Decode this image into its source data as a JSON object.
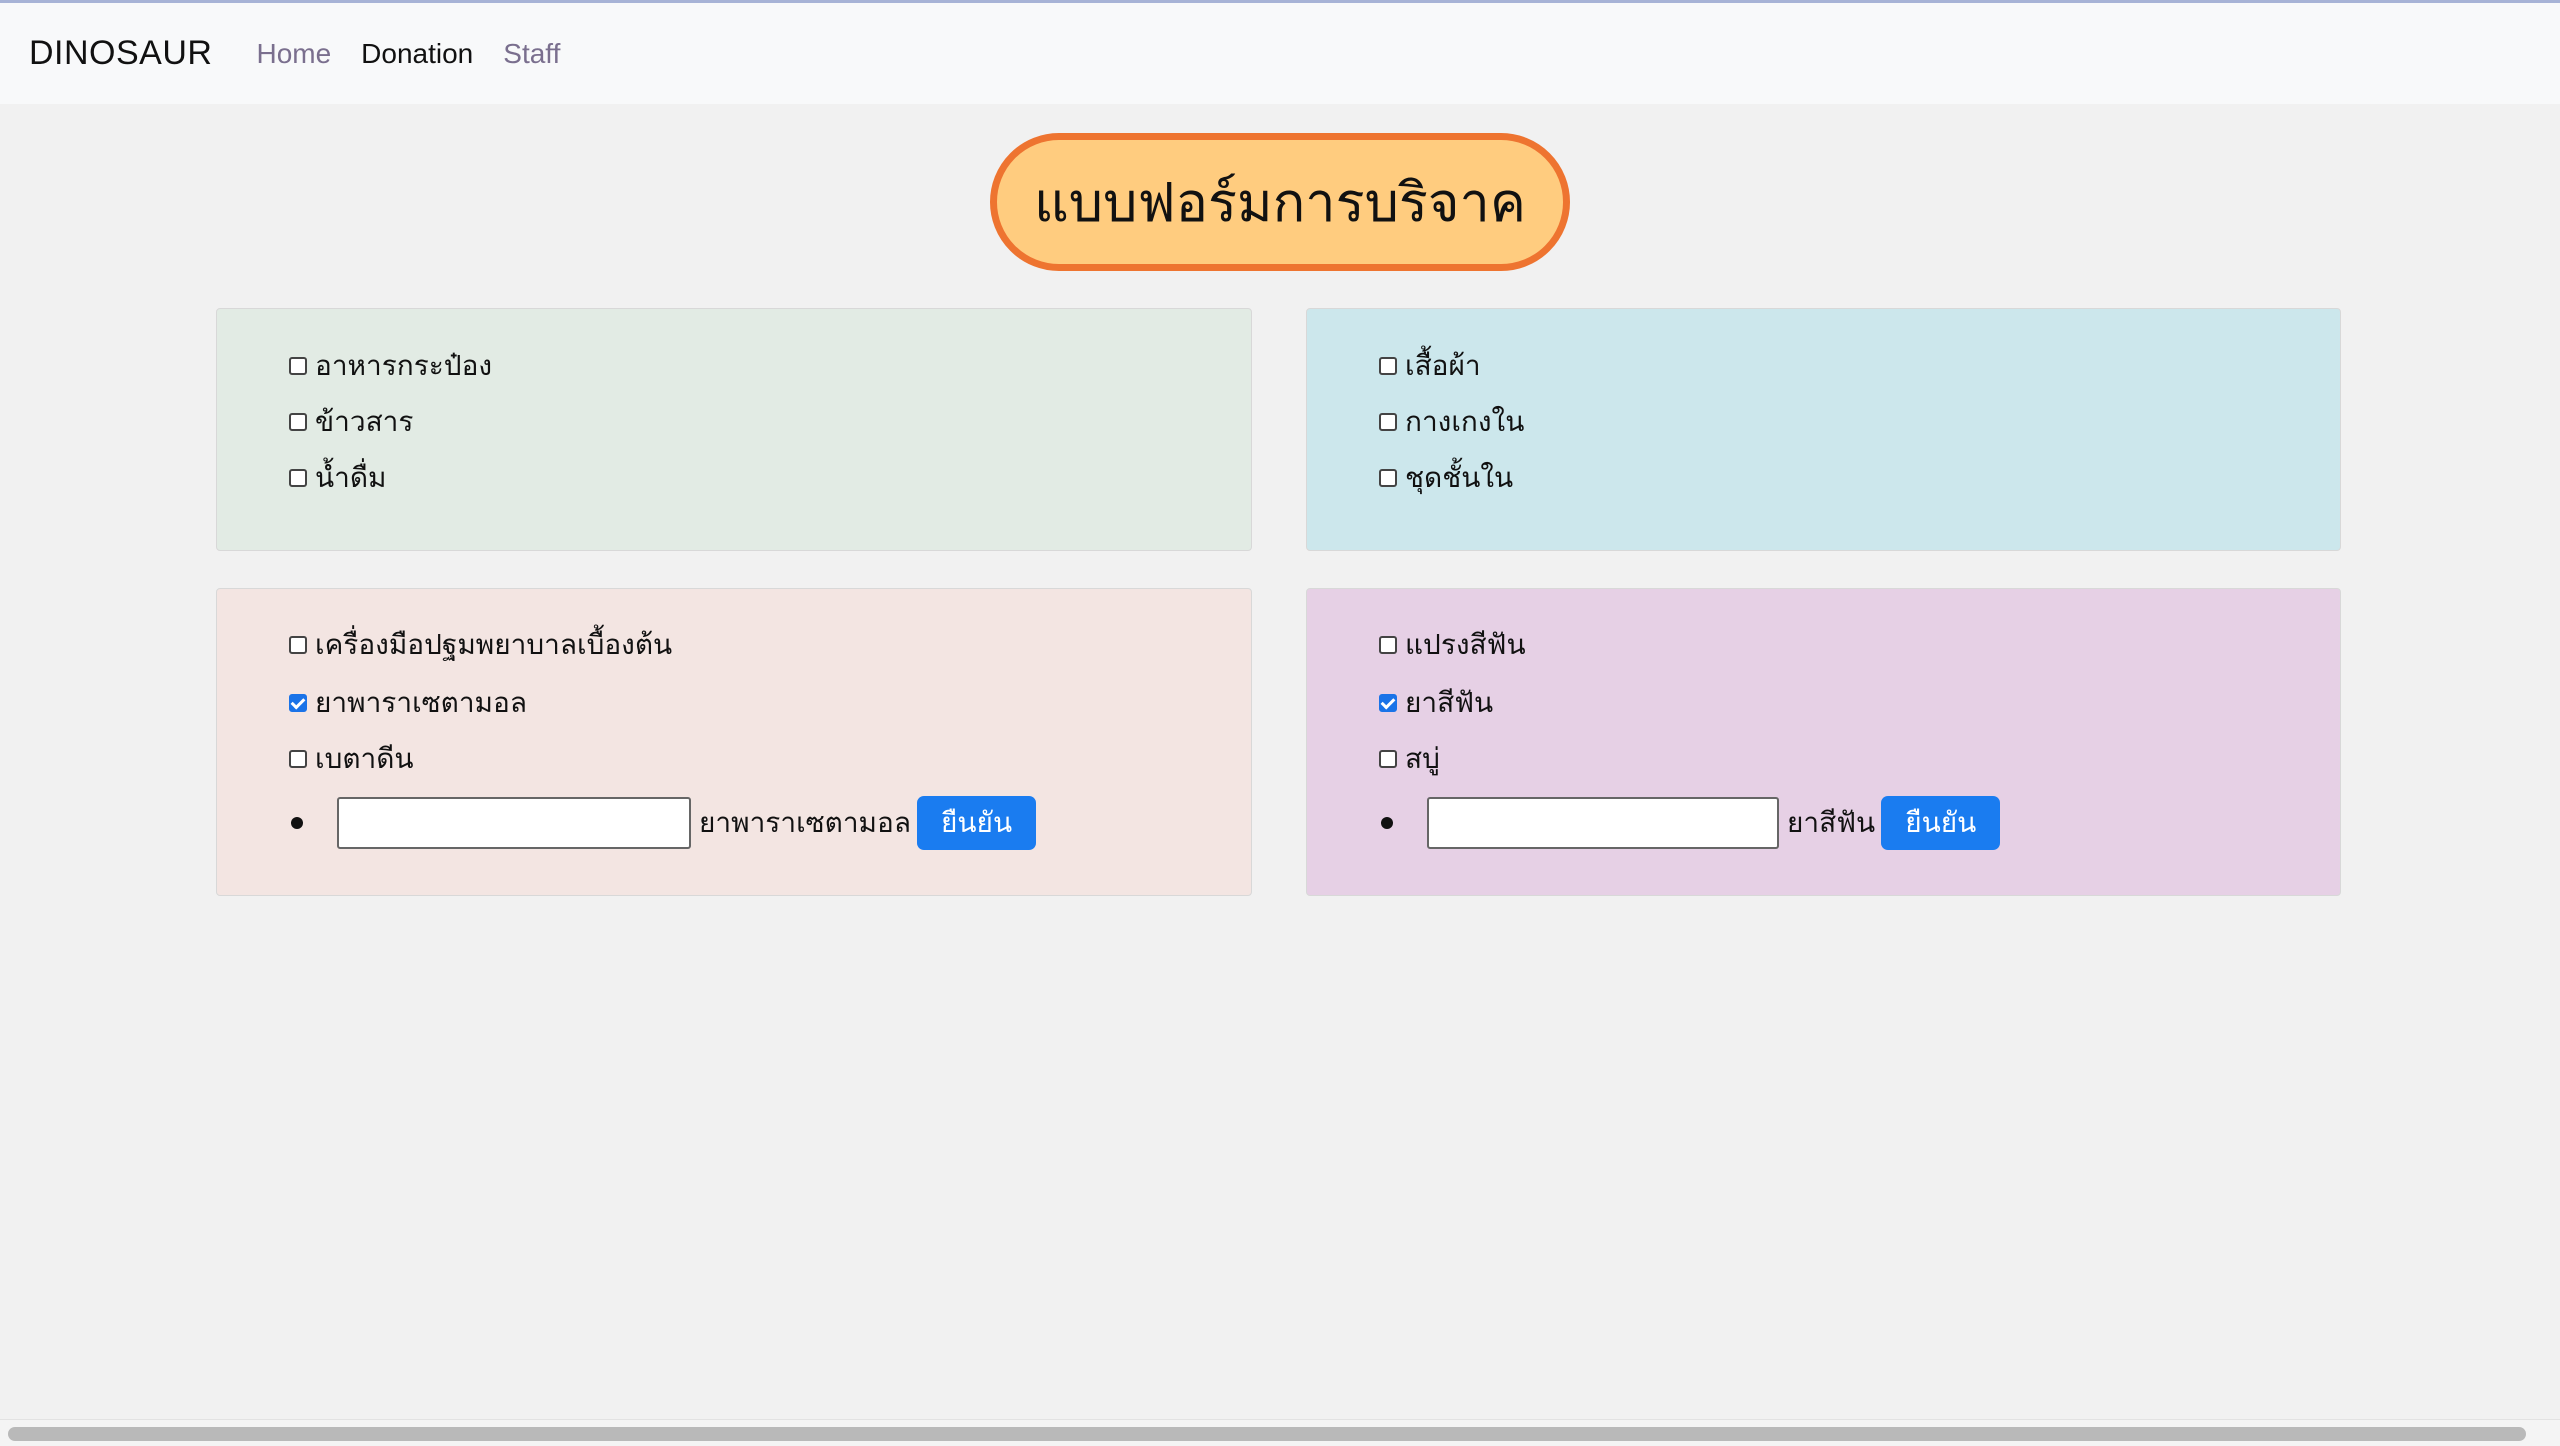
{
  "navbar": {
    "brand": "DINOSAUR",
    "links": [
      {
        "label": "Home",
        "active": false
      },
      {
        "label": "Donation",
        "active": true
      },
      {
        "label": "Staff",
        "active": false
      }
    ]
  },
  "title": "แบบฟอร์มการบริจาค",
  "panels": {
    "food": {
      "items": [
        {
          "label": "อาหารกระป๋อง",
          "checked": false
        },
        {
          "label": "ข้าวสาร",
          "checked": false
        },
        {
          "label": "น้ำดื่ม",
          "checked": false
        }
      ]
    },
    "clothing": {
      "items": [
        {
          "label": "เสื้อผ้า",
          "checked": false
        },
        {
          "label": "กางเกงใน",
          "checked": false
        },
        {
          "label": "ชุดชั้นใน",
          "checked": false
        }
      ]
    },
    "medical": {
      "items": [
        {
          "label": "เครื่องมือปฐมพยาบาลเบื้องต้น",
          "checked": false
        },
        {
          "label": "ยาพาราเซตามอล",
          "checked": true
        },
        {
          "label": "เบตาดีน",
          "checked": false
        }
      ],
      "quantity": {
        "value": "",
        "label": "ยาพาราเซตามอล",
        "button": "ยืนยัน"
      }
    },
    "hygiene": {
      "items": [
        {
          "label": "แปรงสีฟัน",
          "checked": false
        },
        {
          "label": "ยาสีฟัน",
          "checked": true
        },
        {
          "label": "สบู่",
          "checked": false
        }
      ],
      "quantity": {
        "value": "",
        "label": "ยาสีฟัน",
        "button": "ยืนยัน"
      }
    }
  },
  "colors": {
    "accent_orange": "#ee7430",
    "title_fill": "#ffcc7f",
    "button_blue": "#1a7cf0",
    "panel_food": "#e2ebe4",
    "panel_clothing": "#cce7ec",
    "panel_medical": "#f3e5e2",
    "panel_hygiene": "#e6d0e5"
  }
}
